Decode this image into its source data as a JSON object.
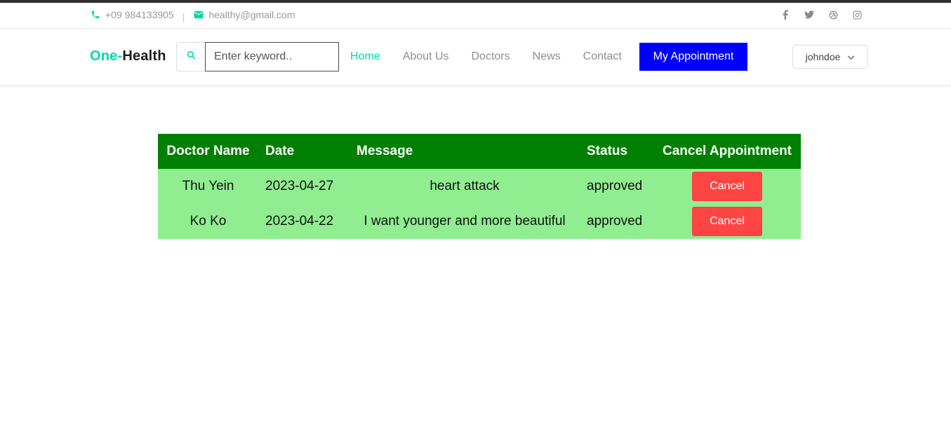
{
  "topbar": {
    "phone": "+09 984133905",
    "separator": "|",
    "email": "healthy@gmail.com",
    "socials": [
      "facebook-icon",
      "twitter-icon",
      "dribbble-icon",
      "instagram-icon"
    ]
  },
  "brand": {
    "part1": "One-",
    "part2": "Health"
  },
  "search": {
    "placeholder": "Enter keyword.."
  },
  "nav": {
    "items": [
      {
        "label": "Home",
        "active": true
      },
      {
        "label": "About Us"
      },
      {
        "label": "Doctors"
      },
      {
        "label": "News"
      },
      {
        "label": "Contact"
      }
    ],
    "appointment_label": "My Appointment"
  },
  "user": {
    "name": "johndoe"
  },
  "table": {
    "headers": [
      "Doctor Name",
      "Date",
      "Message",
      "Status",
      "Cancel Appointment"
    ],
    "rows": [
      {
        "doctor": "Thu Yein",
        "date": "2023-04-27",
        "message": "heart attack",
        "status": "approved",
        "action": "Cancel"
      },
      {
        "doctor": "Ko Ko",
        "date": "2023-04-22",
        "message": "I want younger and more beautiful",
        "status": "approved",
        "action": "Cancel"
      }
    ]
  },
  "colors": {
    "accent": "#00d9a5",
    "appointment_button": "#0000ff",
    "table_header": "#008000",
    "table_body": "#90ee90",
    "cancel_button": "#ff4444"
  }
}
